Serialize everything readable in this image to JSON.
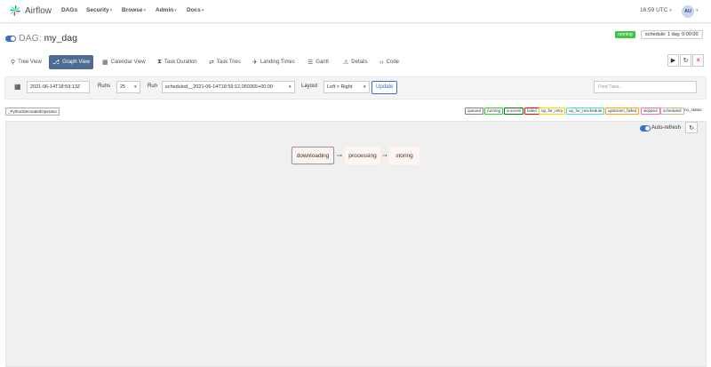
{
  "brand": {
    "name": "Airflow",
    "logo": "airflow-pinwheel-icon"
  },
  "nav": {
    "items": [
      {
        "label": "DAGs",
        "dropdown": false
      },
      {
        "label": "Security",
        "dropdown": true
      },
      {
        "label": "Browse",
        "dropdown": true
      },
      {
        "label": "Admin",
        "dropdown": true
      },
      {
        "label": "Docs",
        "dropdown": true
      }
    ],
    "time": "16:59 UTC",
    "user_initials": "AU"
  },
  "dag": {
    "prefix": "DAG:",
    "name": "my_dag",
    "state": "running",
    "schedule": "schedule: 1 day, 0:00:00"
  },
  "tabs": [
    {
      "label": "Tree View",
      "icon": "tree-icon",
      "active": false
    },
    {
      "label": "Graph View",
      "icon": "graph-icon",
      "active": true
    },
    {
      "label": "Calendar View",
      "icon": "calendar-icon",
      "active": false
    },
    {
      "label": "Task Duration",
      "icon": "hourglass-icon",
      "active": false
    },
    {
      "label": "Task Tries",
      "icon": "retry-icon",
      "active": false
    },
    {
      "label": "Landing Times",
      "icon": "plane-icon",
      "active": false
    },
    {
      "label": "Gantt",
      "icon": "gantt-icon",
      "active": false
    },
    {
      "label": "Details",
      "icon": "warning-icon",
      "active": false
    },
    {
      "label": "Code",
      "icon": "code-icon",
      "active": false
    }
  ],
  "actions": {
    "trigger": "▶",
    "refresh": "↻",
    "delete": "🗑"
  },
  "controls": {
    "base_date": "2021-06-14T18:59:13Z",
    "runs_label": "Runs",
    "runs_value": "25",
    "run_label": "Run",
    "run_value": "scheduled__2021-06-14T18:59:12.050365+00:00",
    "layout_label": "Layout",
    "layout_value": "Left > Right",
    "update_label": "Update",
    "find_placeholder": "Find Task..."
  },
  "operator": "_PythonDecoratedOperator",
  "legend": [
    {
      "label": "queued",
      "color": "#808080"
    },
    {
      "label": "running",
      "color": "#32cd32"
    },
    {
      "label": "success",
      "color": "#008000"
    },
    {
      "label": "failed",
      "color": "#ff0000"
    },
    {
      "label": "up_for_retry",
      "color": "#ffd700"
    },
    {
      "label": "up_for_reschedule",
      "color": "#40e0d0"
    },
    {
      "label": "upstream_failed",
      "color": "#ffa500"
    },
    {
      "label": "skipped",
      "color": "#ff69b4"
    },
    {
      "label": "scheduled",
      "color": "#d2b48c"
    },
    {
      "label": "no_status",
      "color": "#ffffff"
    }
  ],
  "auto_refresh_label": "Auto-refresh",
  "tasks": [
    "downloading",
    "processing",
    "storing"
  ],
  "colors": {
    "accent": "#4e6b93",
    "link": "#3b6fc6",
    "running": "#3bc63b"
  }
}
